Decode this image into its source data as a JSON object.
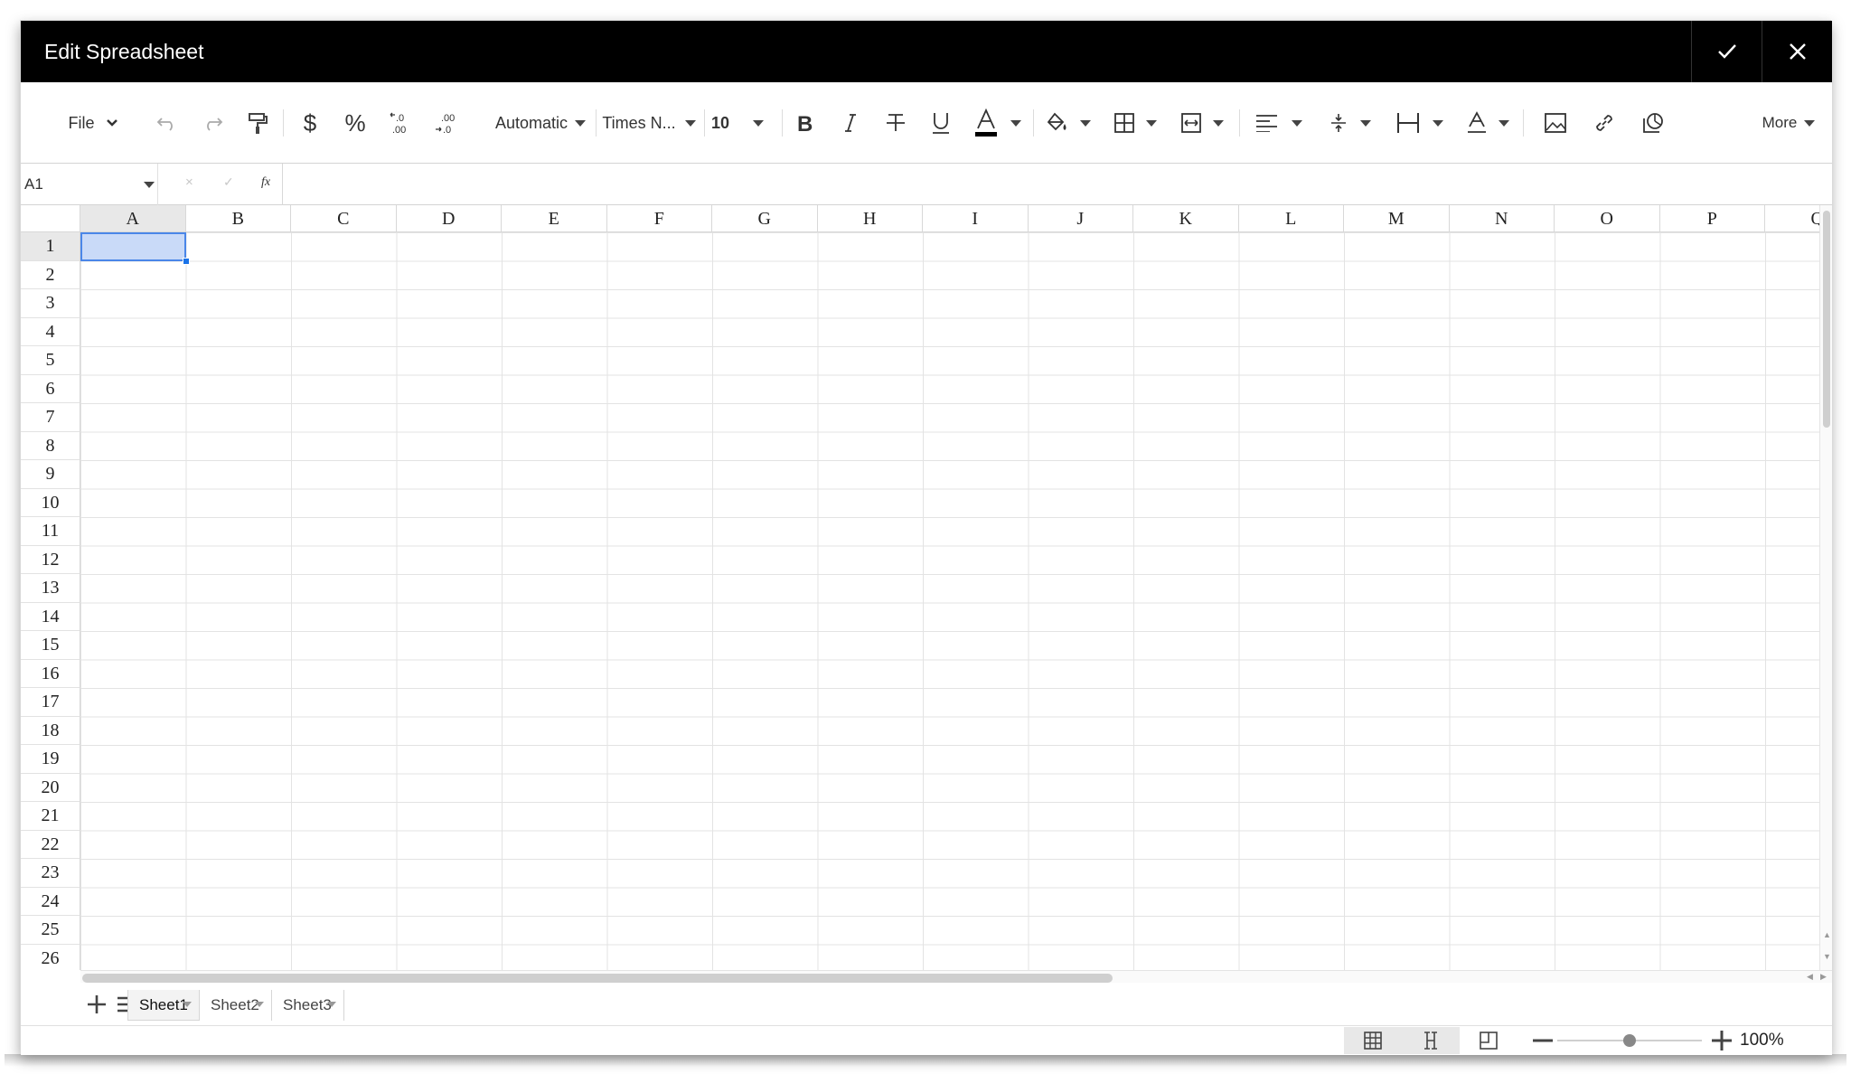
{
  "window": {
    "title": "Edit Spreadsheet",
    "confirm_icon": "check-icon",
    "close_icon": "close-icon"
  },
  "toolbar": {
    "file_label": "File",
    "number_format": "Automatic",
    "font_family": "Times N...",
    "font_size": "10",
    "more_label": "More",
    "decrease_decimal_label": ".0 .00",
    "increase_decimal_label": ".00 .0",
    "currency_symbol": "$",
    "percent_symbol": "%",
    "font_color": "#000000"
  },
  "formula_bar": {
    "cell_reference": "A1",
    "cancel_symbol": "×",
    "confirm_symbol": "✓",
    "fx_label": "fx",
    "value": ""
  },
  "grid": {
    "columns": [
      "A",
      "B",
      "C",
      "D",
      "E",
      "F",
      "G",
      "H",
      "I",
      "J",
      "K",
      "L",
      "M",
      "N",
      "O",
      "P",
      "Q"
    ],
    "rows": [
      "1",
      "2",
      "3",
      "4",
      "5",
      "6",
      "7",
      "8",
      "9",
      "10",
      "11",
      "12",
      "13",
      "14",
      "15",
      "16",
      "17",
      "18",
      "19",
      "20",
      "21",
      "22",
      "23",
      "24",
      "25",
      "26"
    ],
    "selected_cell": "A1",
    "selection_color": "#c9daf8",
    "selection_border_color": "#4a86e8"
  },
  "sheets": {
    "tabs": [
      {
        "label": "Sheet1",
        "active": true
      },
      {
        "label": "Sheet2",
        "active": false
      },
      {
        "label": "Sheet3",
        "active": false
      }
    ]
  },
  "status": {
    "zoom": "100%",
    "zoom_level": 1.0,
    "active_view": "normal"
  }
}
